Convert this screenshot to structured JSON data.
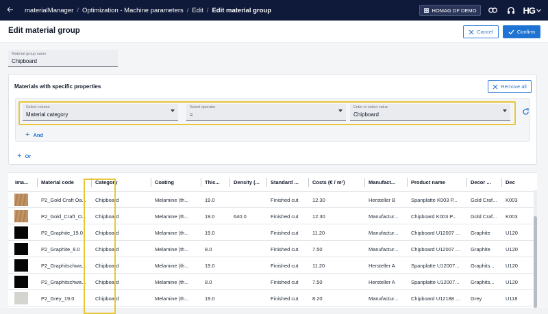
{
  "topbar": {
    "breadcrumbs": [
      "materialManager",
      "Optimization - Machine parameters",
      "Edit",
      "Edit material group"
    ],
    "tenant": "HOMAG DF DEMO",
    "brand": "HG"
  },
  "header": {
    "title": "Edit material group",
    "cancel_label": "Cancel",
    "confirm_label": "Confirm"
  },
  "group_name": {
    "label": "Material group name",
    "value": "Chipboard"
  },
  "filters": {
    "title": "Materials with specific properties",
    "remove_all_label": "Remove all",
    "column": {
      "label": "Select column",
      "value": "Material category"
    },
    "operator": {
      "label": "Select operator",
      "value": "="
    },
    "value": {
      "label": "Enter or select value",
      "value": "Chipboard"
    },
    "and_label": "And",
    "or_label": "Or"
  },
  "table": {
    "columns": [
      "Ima...",
      "Material code",
      "Category",
      "Coating",
      "Thic...",
      "Density (...",
      "Standard ...",
      "Costs (€ / m²)",
      "Manufact...",
      "Product name",
      "Decor ...",
      "Dec"
    ],
    "rows": [
      {
        "image": "wood",
        "code": "P2_Gold Craft Oa...",
        "category": "Chipboard",
        "coating": "Melamine (th...",
        "thickness": "19.0",
        "density": "",
        "standard": "Finished cut",
        "costs": "12.30",
        "manufacturer": "Hersteller B",
        "product": "Spanplatte K003 P...",
        "decor": "Gold Craf...",
        "dec2": "K003"
      },
      {
        "image": "wood",
        "code": "P2_Gold_Craft_O...",
        "category": "Chipboard",
        "coating": "Melamine (th...",
        "thickness": "19.0",
        "density": "640.0",
        "standard": "Finished cut",
        "costs": "12.30",
        "manufacturer": "Manufactur...",
        "product": "Chipboard K003 P...",
        "decor": "Gold Craf...",
        "dec2": "K003"
      },
      {
        "image": "black",
        "code": "P2_Graphite_19.0",
        "category": "Chipboard",
        "coating": "Melamine (th...",
        "thickness": "19.0",
        "density": "",
        "standard": "Finished cut",
        "costs": "11.20",
        "manufacturer": "Manufactur...",
        "product": "Chipboard U12007 ...",
        "decor": "Graphite",
        "dec2": "U120"
      },
      {
        "image": "black",
        "code": "P2_Graphite_8.0",
        "category": "Chipboard",
        "coating": "Melamine (th...",
        "thickness": "8.0",
        "density": "",
        "standard": "Finished cut",
        "costs": "7.50",
        "manufacturer": "Manufactur...",
        "product": "Chipboard U12007 ...",
        "decor": "Graphite",
        "dec2": "U120"
      },
      {
        "image": "black",
        "code": "P2_Graphitschwa...",
        "category": "Chipboard",
        "coating": "Melamine (th...",
        "thickness": "19.0",
        "density": "",
        "standard": "Finished cut",
        "costs": "11.20",
        "manufacturer": "Hersteller A",
        "product": "Spanplatte U12007...",
        "decor": "Graphits...",
        "dec2": "U120"
      },
      {
        "image": "black",
        "code": "P2_Graphitschwa...",
        "category": "Chipboard",
        "coating": "Melamine (th...",
        "thickness": "8.0",
        "density": "",
        "standard": "Finished cut",
        "costs": "7.50",
        "manufacturer": "Hersteller A",
        "product": "Spanplatte U12007...",
        "decor": "Graphits...",
        "dec2": "U120"
      },
      {
        "image": "grey",
        "code": "P2_Grey_19.0",
        "category": "Chipboard",
        "coating": "Melamine (th...",
        "thickness": "19.0",
        "density": "",
        "standard": "Finished cut",
        "costs": "8.20",
        "manufacturer": "Manufactur...",
        "product": "Chipboard U12188 ...",
        "decor": "Grey",
        "dec2": "U118"
      }
    ]
  },
  "colors": {
    "topbar": "#0f1a3a",
    "accent": "#1f73d2",
    "highlight": "#e8c63a"
  }
}
